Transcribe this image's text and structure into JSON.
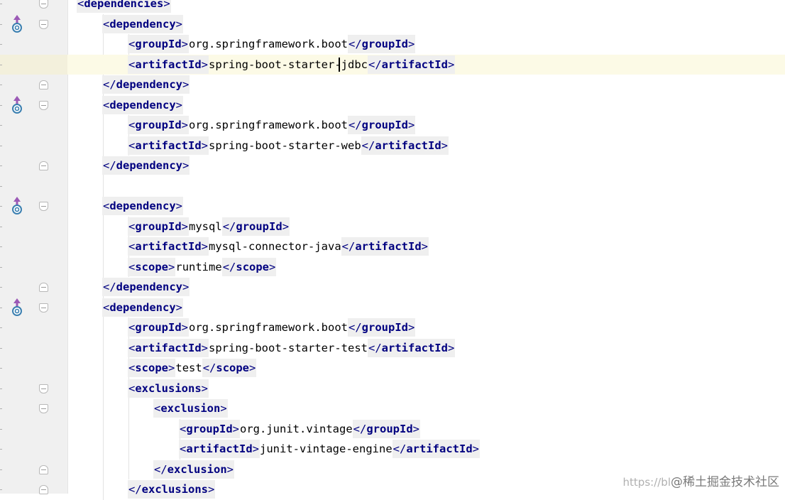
{
  "editor": {
    "file_type": "pom.xml",
    "lines": [
      {
        "indent": 0,
        "tag": "dependencies",
        "kind": "open",
        "fold": "open"
      },
      {
        "indent": 1,
        "tag": "dependency",
        "kind": "open",
        "fold": "open",
        "icon": "maven-dependency-icon"
      },
      {
        "indent": 2,
        "tag": "groupId",
        "kind": "element",
        "value": "org.springframework.boot"
      },
      {
        "indent": 2,
        "tag": "artifactId",
        "kind": "element",
        "value": "spring-boot-starter-jdbc",
        "current": true
      },
      {
        "indent": 1,
        "tag": "dependency",
        "kind": "close",
        "fold": "close"
      },
      {
        "indent": 1,
        "tag": "dependency",
        "kind": "open",
        "fold": "open",
        "icon": "maven-dependency-icon"
      },
      {
        "indent": 2,
        "tag": "groupId",
        "kind": "element",
        "value": "org.springframework.boot"
      },
      {
        "indent": 2,
        "tag": "artifactId",
        "kind": "element",
        "value": "spring-boot-starter-web"
      },
      {
        "indent": 1,
        "tag": "dependency",
        "kind": "close",
        "fold": "close"
      },
      {
        "kind": "blank"
      },
      {
        "indent": 1,
        "tag": "dependency",
        "kind": "open",
        "fold": "open",
        "icon": "maven-dependency-icon"
      },
      {
        "indent": 2,
        "tag": "groupId",
        "kind": "element",
        "value": "mysql"
      },
      {
        "indent": 2,
        "tag": "artifactId",
        "kind": "element",
        "value": "mysql-connector-java"
      },
      {
        "indent": 2,
        "tag": "scope",
        "kind": "element",
        "value": "runtime"
      },
      {
        "indent": 1,
        "tag": "dependency",
        "kind": "close",
        "fold": "close"
      },
      {
        "indent": 1,
        "tag": "dependency",
        "kind": "open",
        "fold": "open",
        "icon": "maven-dependency-icon"
      },
      {
        "indent": 2,
        "tag": "groupId",
        "kind": "element",
        "value": "org.springframework.boot"
      },
      {
        "indent": 2,
        "tag": "artifactId",
        "kind": "element",
        "value": "spring-boot-starter-test"
      },
      {
        "indent": 2,
        "tag": "scope",
        "kind": "element",
        "value": "test"
      },
      {
        "indent": 2,
        "tag": "exclusions",
        "kind": "open",
        "fold": "open"
      },
      {
        "indent": 3,
        "tag": "exclusion",
        "kind": "open",
        "fold": "open"
      },
      {
        "indent": 4,
        "tag": "groupId",
        "kind": "element",
        "value": "org.junit.vintage"
      },
      {
        "indent": 4,
        "tag": "artifactId",
        "kind": "element",
        "value": "junit-vintage-engine"
      },
      {
        "indent": 3,
        "tag": "exclusion",
        "kind": "close",
        "fold": "close"
      },
      {
        "indent": 2,
        "tag": "exclusions",
        "kind": "close",
        "fold": "close"
      }
    ]
  },
  "colors": {
    "tag_name": "#000080",
    "tag_background": "#efefef",
    "text": "#000000",
    "current_line": "#fcfae6",
    "gutter": "#f0f0f0",
    "maven_icon_arrow": "#9b59b6",
    "maven_icon_circle": "#3a7fb0"
  },
  "watermark": {
    "url": "https://bl",
    "label": "@稀土掘金技术社区"
  }
}
